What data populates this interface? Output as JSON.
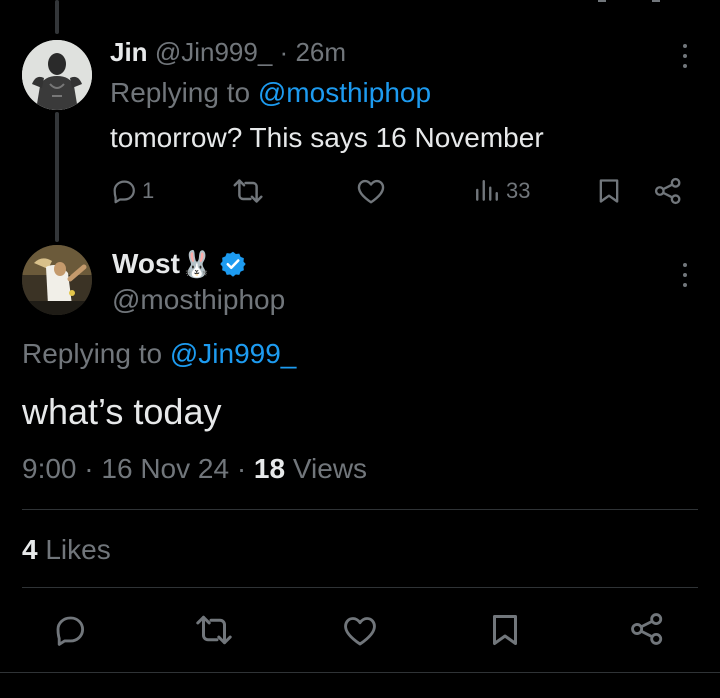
{
  "parent_reply": {
    "author_name": "Jin",
    "author_handle": "@Jin999_",
    "separator": "·",
    "time_ago": "26m",
    "replying_label": "Replying to",
    "replying_to": "@mosthiphop",
    "text": "tomorrow? This says 16 November",
    "reply_count": "1",
    "view_count": "33"
  },
  "main_tweet": {
    "author_name": "Wost",
    "name_emoji": "🐰",
    "author_handle": "@mosthiphop",
    "replying_label": "Replying to",
    "replying_to": "@Jin999_",
    "text": "what’s today",
    "time": "9:00",
    "date": "16 Nov 24",
    "separator": "·",
    "views_count": "18",
    "views_label": "Views",
    "likes_count": "4",
    "likes_label": "Likes"
  },
  "colors": {
    "background": "#000000",
    "text": "#e7e9ea",
    "secondary_text": "#71767b",
    "link": "#1d9bf0",
    "verified": "#1d9bf0"
  },
  "icons": [
    "reply-icon",
    "retweet-icon",
    "like-icon",
    "views-icon",
    "bookmark-icon",
    "share-icon",
    "more-icon",
    "verified-badge-icon"
  ]
}
